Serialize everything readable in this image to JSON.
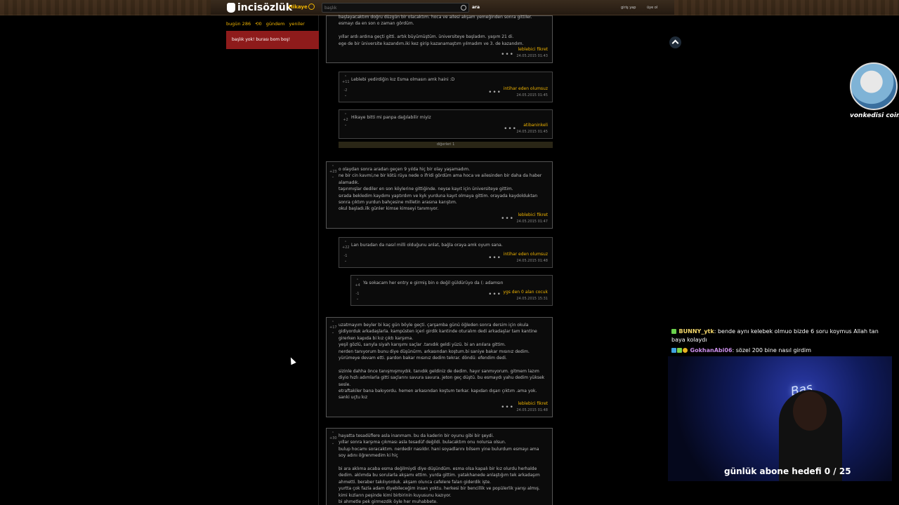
{
  "header": {
    "logo": "incisözlük",
    "category": "Hikaye",
    "search_placeholder": "başlık",
    "search_button": "ara",
    "login": "giriş yap",
    "register": "üye ol"
  },
  "left": {
    "tab_today": "bugün 286",
    "tab_count": "0",
    "tab_agenda": "gündem",
    "tab_new": "yeniler",
    "empty_title": "başlık yok! burası bom boş!"
  },
  "entries": [
    {
      "text": "başlayacaktım doğru düzgün bir olacaktım. hoca ve ailesi akşam yemeğinden sonra gittiler. esmayı da en son o zaman gördüm.\n\nyıllar ardı ardına geçti gitti. artık büyümüştüm. üniversiteye başladım. yaşım 21 di.\nege de bir üniversite kazandım.iki kez girip kazanamaştım yılmadım ve 3. de kazandım.",
      "author": "leblebici fikret",
      "date": "24.05.2015 01:43"
    },
    {
      "text": "Leblebi yedirdiğin kız Esma olmasın amk haini :D",
      "up": "+11",
      "down": "-2",
      "author": "intihar eden olumsuz",
      "date": "24.05.2015 01:45"
    },
    {
      "text": "Hikaye bitti mi panpa dağılabilir miyiz",
      "up": "+2",
      "author": "atibaninkeli",
      "date": "24.05.2015 01:45"
    },
    {
      "text": "o olaydan sonra aradan geçen 9 yılda hiç bir olay yaşamadım.\nne bir cin kavmi,ne bir kötü rüya nede o ifridi gördüm ama hoca ve ailesinden bir daha da haber alamadık.\ntaşınmışlar dediler en son köylerine gittiğinde. neyse kayıt için üniversiteye gittim.\nsırada bekledim kaydımı yaptırdım ve kyk yurduna kayıt olmaya gittim. orayada kaydolduktan sonra çıktım yurdun bahçesine milletin arasına karıştım.\nokul başladı.ilk günler kimse kimseyi tanımıyor.",
      "up": "+23",
      "author": "leblebici fikret",
      "date": "24.05.2015 01:47"
    },
    {
      "text": "Lan buradan da nasıl milli olduğunu anlat, bağla oraya amk oyum sana.",
      "up": "+22",
      "down": "-1",
      "author": "intihar eden olumsuz",
      "date": "24.05.2015 01:48"
    },
    {
      "text": "Ya sokacam her entry e girmiş bin o değil güldürüyo da (: adamsın",
      "up": "+4",
      "down": "-1",
      "author": "ygs den 0 alan cocuk",
      "date": "24.05.2015 15:31"
    },
    {
      "text": "uzatmayım beyler bi kaç gün böyle geçti. çarşamba günü öğleden sonra dersim için okula gidiyorduk arkadaşlarla. kampüsten içeri girdik kantinde oturalım dedi arkadaşlar tam kantine girerken kapıda bi kız çıktı karşıma.\nyeşil gözlü, sarıyla siyah karışımı saçlar .tanıdık geldi yüzü. bi an anılara gittim.\nnerden tanıyorum bunu diye düşünürm. arkasından koştum.bi saniye bakar mısınız dedim.\nyürümeye devam etti. pardon bakar mısınız dedim tekrar. döndü: efendim dedi.\n\nsizinle dahha önce tanışmışmıydık. tanıdık geldiniz de dedim. hayır sanmıyorum. gitmem lazım diyio hızlı adımlarla gitti saçlarını savura savura. jeton geç düştü. bu esmaydı yahu dedim yüksek sesle.\netraftakiler bana bakıyordu. hemen arkasından koştum terkar. kapıdan dışarı çıktım .ama yok. sanki uçtu kız",
      "up": "+17",
      "author": "leblebici fikret",
      "date": "24.05.2015 01:48"
    },
    {
      "text": "hayatta tesadüflere asla inanmam. bu da kaderin bir oyunu gibi bir şeydi.\nyıllar sonra karşıma çıkması asla tesadüf değildi. bulacaktım onu nolursa olsun.\nbulup hocamı soracaktım. nerdedir nasıldır. hani soyadlarını bilsem yine bulurdum esmayı ama soy adını öğrenmedim ki hiç\n\nbi ara aklıma acaba esma değilmiydi diye düşündüm. esma olsa kapalı bir kız olurdu herhalde dedim. aklımda bu sorularla akşamı ettim. yurda gittim. yatakhanede anlaştığım tek arkadaşım ahmetti. beraber takılıyorduk. akşam olunca cafelere falan giderdik işte.\nyurtta çok fazla adam diyebileceğim insan yoktu. herkesi bir bencillik ve popülerlik yarışı almış.\nkimi kızların peşinde kimi birbirinin kuyusunu kazıyor.\nbi ahmetle pek girmezdik öyle her muhabbete.",
      "up": "+30"
    }
  ],
  "others_label": "diğerleri 1",
  "stream": {
    "avatar_name": "vonkedisi coin",
    "chat": [
      {
        "user": "BUNNY_ytk",
        "message": "bende aynı kelebek olmuo bizde 6 soru koymus Allah tan baya kolaydı"
      },
      {
        "user": "GokhanAbi06",
        "message": "sözel 200 bine nasıl girdim"
      }
    ],
    "webcam_sign": "Bas",
    "goal_text": "günlük abone hedefi 0 / 25"
  },
  "colors": {
    "accent": "#f0b400",
    "alert": "#8e1b1b"
  }
}
